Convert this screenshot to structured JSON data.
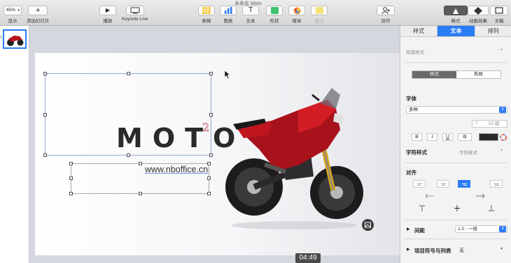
{
  "toolbar": {
    "doc_title": "未命名 Moto",
    "zoom_value": "45%",
    "zoom_label": "显示",
    "add_slide_label": "添加幻灯片",
    "play_label": "播放",
    "keynote_live_label": "Keynote Live",
    "table_label": "表格",
    "chart_label": "图表",
    "text_label": "文本",
    "shape_label": "形状",
    "media_label": "媒体",
    "comment_label": "批注",
    "collaborate_label": "协作",
    "format_label": "格式",
    "animate_label": "动画效果",
    "document_label": "文稿"
  },
  "navigator": {
    "slide_number": "1"
  },
  "slide": {
    "title_text": "MOTO",
    "superscript": "2",
    "url_text": "www.nboffice.cn"
  },
  "inspector": {
    "tabs": [
      "样式",
      "文本",
      "排列"
    ],
    "paragraph_style": "段落样式",
    "seg_style": "样式",
    "seg_layout": "布局",
    "font_header": "字体",
    "font_value": "多种",
    "font_size": "52 磅",
    "bold": "B",
    "italic": "I",
    "underline": "U",
    "char_style_label": "字符样式",
    "char_style_value": "字符样式",
    "alignment_header": "对齐",
    "spacing_label": "间距",
    "spacing_value": "1.0 - 一倍",
    "bullets_label": "项目符号与列表",
    "bullets_value": "无"
  },
  "status": {
    "timestamp": "04:49"
  },
  "colors": {
    "accent": "#2b7cf6"
  }
}
